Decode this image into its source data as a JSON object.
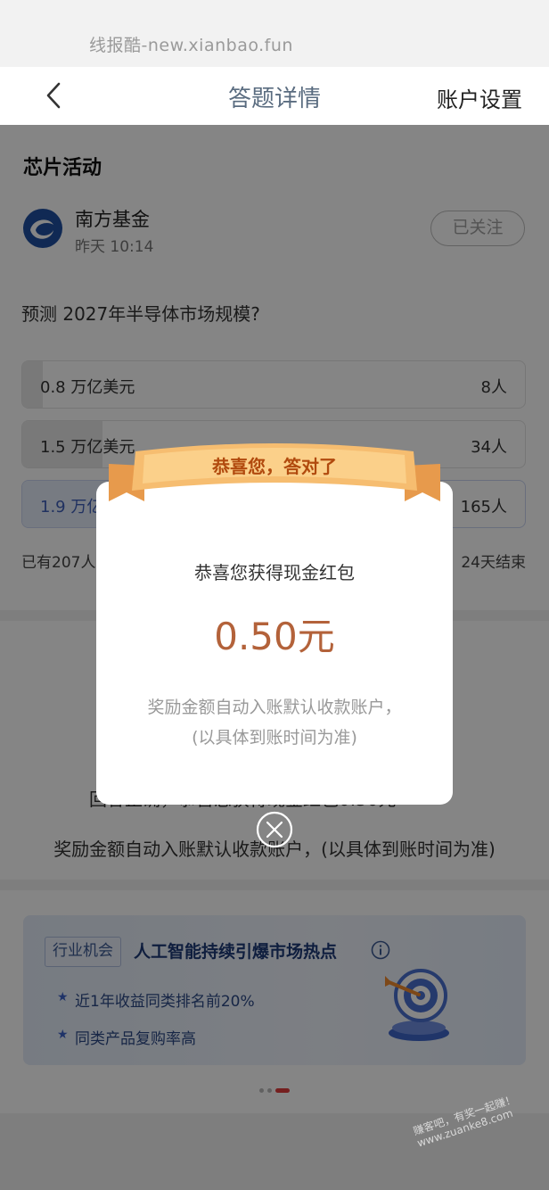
{
  "watermark": "线报酷-new.xianbao.fun",
  "header": {
    "title": "答题详情",
    "right_link": "账户设置"
  },
  "section": {
    "title": "芯片活动"
  },
  "brand": {
    "name": "南方基金",
    "time": "昨天 10:14",
    "follow_label": "已关注"
  },
  "question": "预测 2027年半导体市场规模?",
  "options": [
    {
      "label": "0.8 万亿美元",
      "count": "8人",
      "share": 0.04
    },
    {
      "label": "1.5 万亿美元",
      "count": "34人",
      "share": 0.16
    },
    {
      "label": "1.9 万亿",
      "count": "165人",
      "share": 0.8
    }
  ],
  "footer": {
    "left": "已有207人",
    "right": "24天结束"
  },
  "result": {
    "line": "回答正确，恭喜您获得现金红包0.50元",
    "note": "奖励金额自动入账默认收款账户，(以具体到账时间为准)"
  },
  "banner": {
    "tag": "行业机会",
    "title": "人工智能持续引爆市场热点",
    "items": [
      "近1年收益同类排名前20%",
      "同类产品复购率高"
    ]
  },
  "modal": {
    "ribbon": "恭喜您，答对了",
    "subtitle": "恭喜您获得现金红包",
    "amount": "0.50元",
    "note_line1": "奖励金额自动入账默认收款账户，",
    "note_line2": "(以具体到账时间为准)"
  },
  "corner_watermark": {
    "line1": "赚客吧，有奖一起赚！",
    "line2": "www.zuanke8.com"
  },
  "colors": {
    "accent_brand": "#1f4fa1",
    "amount": "#b3623a",
    "ribbon": "#f4b66a",
    "dot_active": "#e03c3c"
  }
}
